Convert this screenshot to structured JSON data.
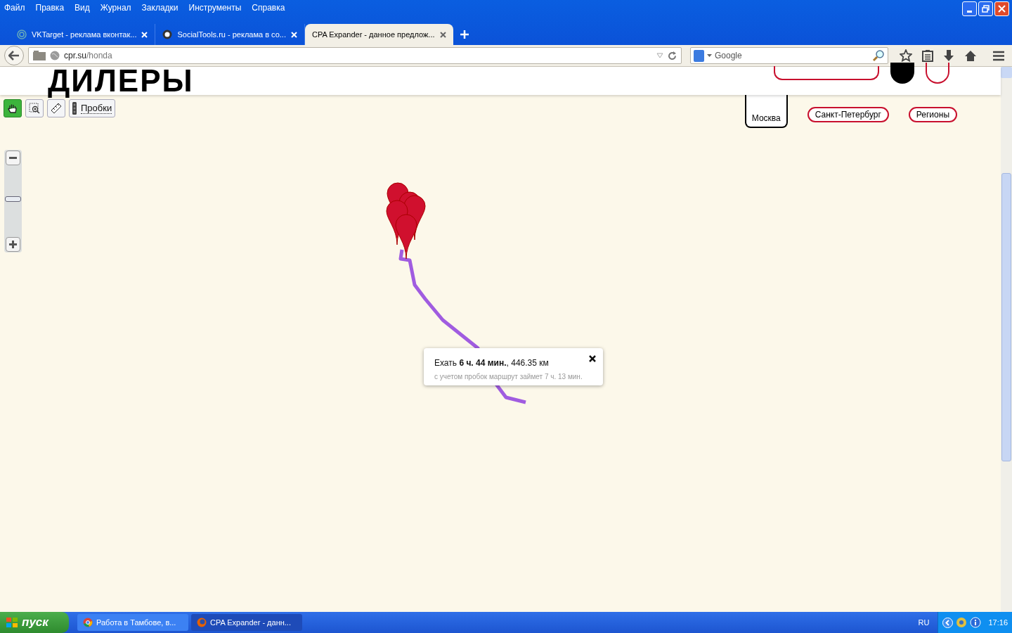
{
  "menu": [
    "Файл",
    "Правка",
    "Вид",
    "Журнал",
    "Закладки",
    "Инструменты",
    "Справка"
  ],
  "tabs": [
    {
      "title": "VKTarget - реклама вконтак...",
      "selected": false
    },
    {
      "title": "SocialTools.ru - реклама в со...",
      "selected": false
    },
    {
      "title": "CPA Expander - данное предлож...",
      "selected": true
    }
  ],
  "address": {
    "host": "cpr.su",
    "path": "/honda"
  },
  "search": {
    "placeholder": "Google"
  },
  "page": {
    "heading": "ДИЛЕРЫ",
    "map": {
      "tools": [
        {
          "kind": "pan",
          "selected": true
        },
        {
          "kind": "zoom_area",
          "selected": false
        },
        {
          "kind": "ruler",
          "selected": false
        },
        {
          "kind": "traffic",
          "label": "Пробки",
          "selected": false
        }
      ],
      "zoom": {
        "level": 0.53
      },
      "city_tabs": [
        {
          "label": "Москва",
          "selected": true
        },
        {
          "label": "Санкт-Петербург",
          "selected": false
        },
        {
          "label": "Регионы",
          "selected": false
        }
      ],
      "route_popup": {
        "text": "Ехать **6 ч. 44 мин.**, 446.35 км",
        "note": "с учетом пробок маршрут займет 7 ч. 13 мин."
      }
    }
  },
  "taskbar": {
    "start": "пуск",
    "tasks": [
      {
        "label": "Работа в Тамбове, в...",
        "selected": false
      },
      {
        "label": "CPA Expander - данн...",
        "selected": true
      }
    ],
    "language": "RU",
    "clock": "17:16"
  }
}
